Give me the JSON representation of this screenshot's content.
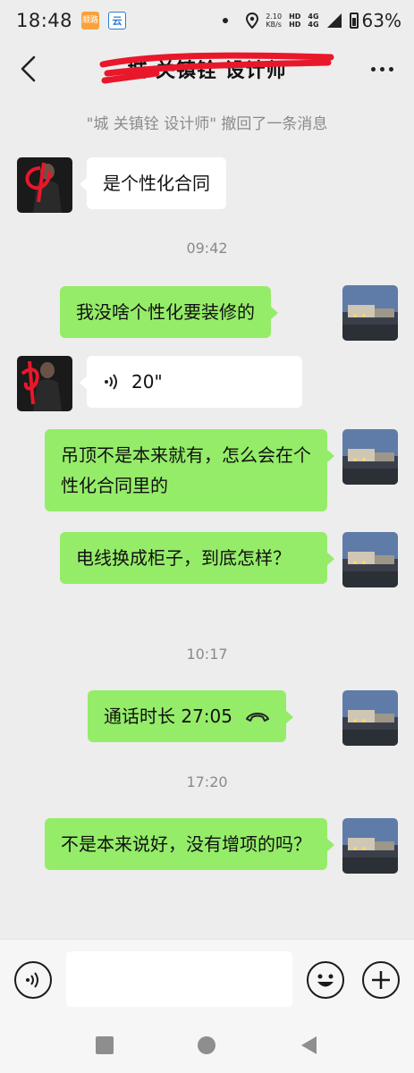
{
  "status_bar": {
    "time": "18:48",
    "app_icon_1": "顺路",
    "app_icon_2": "云",
    "net_speed_value": "2.10",
    "net_speed_unit": "KB/s",
    "signal_1": "4G",
    "signal_2": "4G",
    "battery": "63%"
  },
  "header": {
    "title": "城 关镇铨 设计师",
    "back_icon": "chevron-left-icon",
    "more_icon": "more-dots-icon"
  },
  "recall_notice": "\"城 关镇铨 设计师\" 撤回了一条消息",
  "timestamps": [
    "09:42",
    "10:17",
    "17:20"
  ],
  "messages": [
    {
      "side": "in",
      "text": "是个性化合同"
    },
    {
      "side": "out",
      "text": "我没啥个性化要装修的"
    },
    {
      "side": "in",
      "type": "voice",
      "duration": "20\""
    },
    {
      "side": "out",
      "text": "吊顶不是本来就有，怎么会在个性化合同里的"
    },
    {
      "side": "out",
      "text": "电线换成柜子，到底怎样？"
    },
    {
      "side": "out",
      "type": "call",
      "text": "通话时长 27:05"
    },
    {
      "side": "out",
      "text": "不是本来说好，没有增项的吗？"
    }
  ],
  "input_bar": {
    "voice_icon": "voice-mode-icon",
    "emoji_icon": "emoji-icon",
    "plus_icon": "plus-icon",
    "text_value": ""
  },
  "nav_bar": {
    "recent_icon": "square-icon",
    "home_icon": "circle-icon",
    "back_icon": "triangle-back-icon"
  },
  "colors": {
    "background": "#ededed",
    "outgoing_bubble": "#95ec69",
    "incoming_bubble": "#ffffff",
    "meta_text": "#8a8a8a",
    "scribble": "#e8182a"
  }
}
